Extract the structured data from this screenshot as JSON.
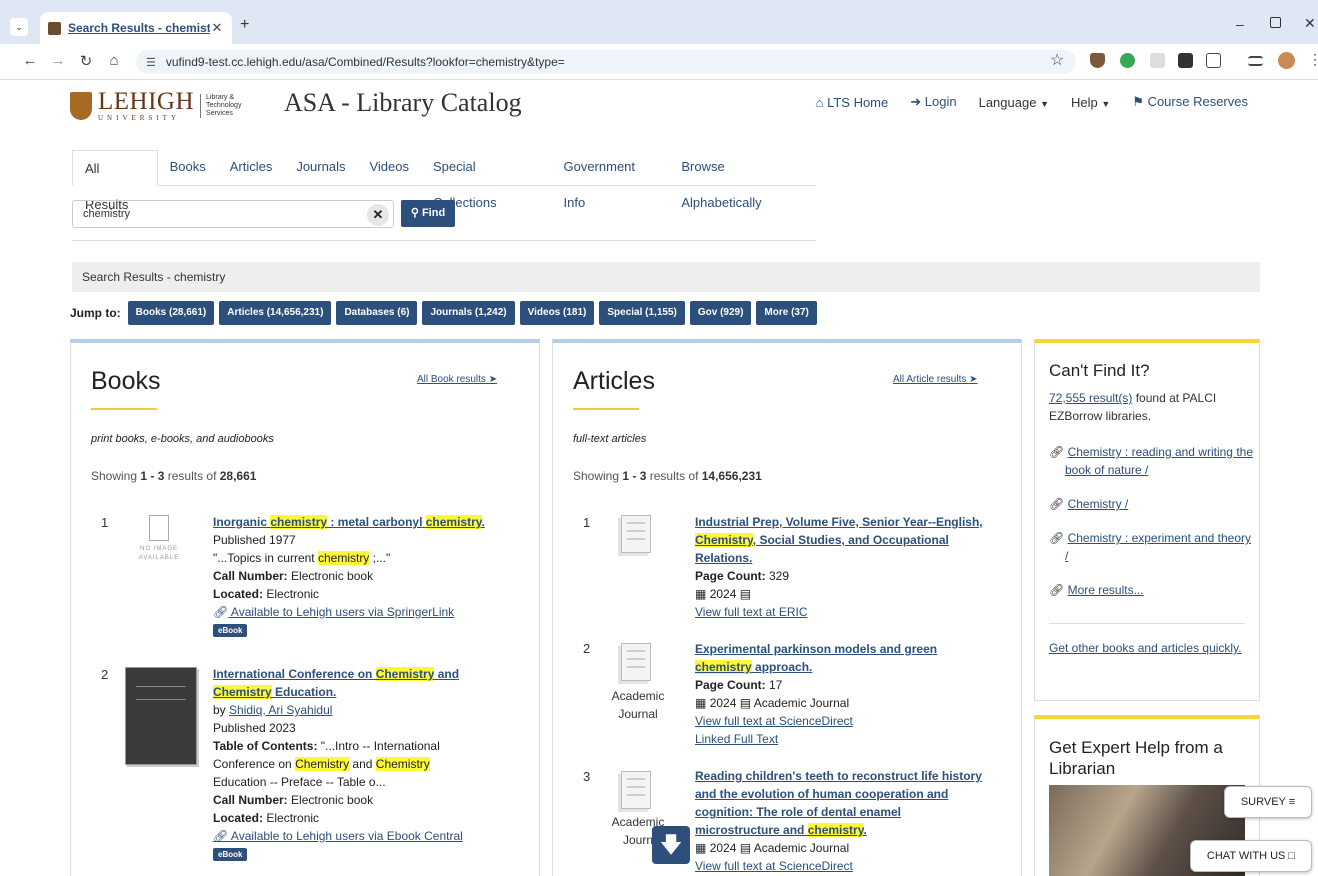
{
  "browser": {
    "tab_title": "Search Results - chemistry :: Lib",
    "url": "vufind9-test.cc.lehigh.edu/asa/Combined/Results?lookfor=chemistry&type="
  },
  "header": {
    "logo_name": "LEHIGH",
    "logo_university": "UNIVERSITY",
    "logo_dept": "Library & Technology Services",
    "title": "ASA - Library Catalog",
    "nav": {
      "lts_home": "LTS Home",
      "login": "Login",
      "language": "Language",
      "help": "Help",
      "course_reserves": "Course Reserves"
    }
  },
  "tabs": [
    "All Results",
    "Books",
    "Articles",
    "Journals",
    "Videos",
    "Special Collections",
    "Government Info",
    "Browse Alphabetically"
  ],
  "search": {
    "value": "chemistry",
    "find_label": "Find"
  },
  "breadcrumb": "Search Results - chemistry",
  "jump": {
    "label": "Jump to:",
    "buttons": [
      "Books (28,661)",
      "Articles (14,656,231)",
      "Databases (6)",
      "Journals (1,242)",
      "Videos (181)",
      "Special (1,155)",
      "Gov (929)",
      "More (37)"
    ]
  },
  "books": {
    "title": "Books",
    "all_link": "All Book results",
    "desc": "print books, e-books, and audiobooks",
    "show_a": "Showing ",
    "show_range": "1 - 3",
    "show_b": " results of ",
    "show_total": "28,661",
    "item1": {
      "num": "1",
      "noimage": "NO IMAGE AVAILABLE",
      "t1": "Inorganic ",
      "t2": "chemistry",
      "t3": " : metal carbonyl ",
      "t4": "chemistry",
      "t5": ".",
      "published": "Published 1977",
      "s1": "\"...Topics in current ",
      "s2": "chemistry",
      "s3": " ;...\"",
      "call_label": "Call Number:",
      "call_value": " Electronic book",
      "loc_label": "Located:",
      "loc_value": " Electronic",
      "access": "Available to Lehigh users via SpringerLink",
      "badge": "eBook"
    },
    "item2": {
      "num": "2",
      "t1": "International Conference on ",
      "t2": "Chemistry",
      "t3": " and",
      "t4": "Chemistry",
      "t5": " Education.",
      "by": "by ",
      "author": "Shidiq, Ari Syahidul",
      "published": "Published 2023",
      "toc_label": "Table of Contents:",
      "toc1": " \"...Intro -- International",
      "toc2": "Conference on ",
      "toc3": "Chemistry",
      "toc4": " and ",
      "toc5": "Chemistry",
      "toc6": "Education -- Preface -- Table o...",
      "call_label": "Call Number:",
      "call_value": " Electronic book",
      "loc_label": "Located:",
      "loc_value": " Electronic",
      "access": "Available to Lehigh users via Ebook Central",
      "badge": "eBook"
    }
  },
  "articles": {
    "title": "Articles",
    "all_link": "All Article results",
    "desc": "full-text articles",
    "show_a": "Showing ",
    "show_range": "1 - 3",
    "show_b": " results of ",
    "show_total": "14,656,231",
    "item1": {
      "num": "1",
      "t1": "Industrial Prep, Volume Five, Senior Year--English,",
      "t2": "Chemistry",
      "t3": ", Social Studies, and Occupational",
      "t4": "Relations.",
      "pc_label": "Page Count:",
      "pc_value": " 329",
      "year": "2024",
      "fulltext": "View full text at ERIC"
    },
    "item2": {
      "num": "2",
      "cat1": "Academic",
      "cat2": "Journal",
      "t1": "Experimental parkinson models and green",
      "t2": "chemistry",
      "t3": " approach.",
      "pc_label": "Page Count:",
      "pc_value": " 17",
      "year": "2024",
      "type": "Academic Journal",
      "fulltext": "View full text at ScienceDirect",
      "linked": "Linked Full Text"
    },
    "item3": {
      "num": "3",
      "cat1": "Academic",
      "cat2": "Journ",
      "t1": "Reading children's teeth to reconstruct life history",
      "t2": "and the evolution of human cooperation and",
      "t3": "cognition: The role of dental enamel",
      "t4": "microstructure and ",
      "t5": "chemistry",
      "t6": ".",
      "year": "2024",
      "type": "Academic Journal",
      "fulltext": "View full text at ScienceDirect"
    }
  },
  "sidebar": {
    "title": "Can't Find It?",
    "count": "72,555 result(s)",
    "count_suffix": " found at PALCI EZBorrow libraries.",
    "links": [
      "Chemistry : reading and writing the book of nature /",
      "Chemistry /",
      "Chemistry : experiment and theory /",
      "More results..."
    ],
    "other": "Get other books and articles quickly."
  },
  "expert": {
    "title": "Get Expert Help from a Librarian"
  },
  "widgets": {
    "survey": "SURVEY",
    "chat": "CHAT WITH US"
  },
  "colors": {
    "brand": "#2c4f7c",
    "highlight": "#fff83a",
    "accent": "#f6c93d",
    "lehigh_brown": "#653819"
  }
}
